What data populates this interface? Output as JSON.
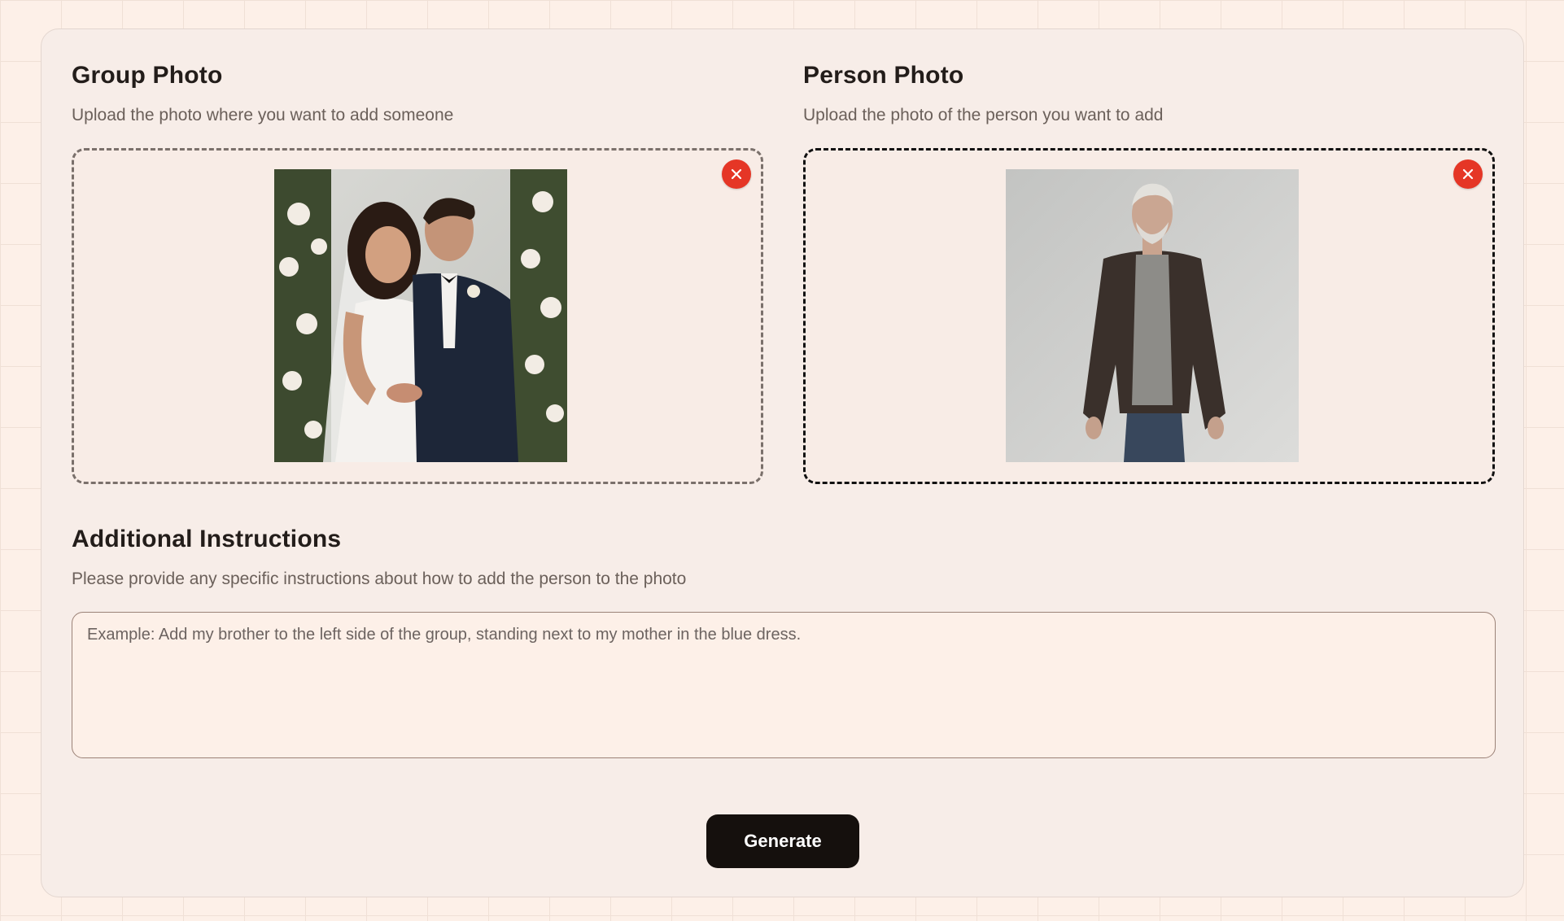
{
  "group_photo": {
    "title": "Group Photo",
    "subtitle": "Upload the photo where you want to add someone",
    "image_alt": "Wedding couple photo"
  },
  "person_photo": {
    "title": "Person Photo",
    "subtitle": "Upload the photo of the person you want to add",
    "image_alt": "Elderly man portrait"
  },
  "instructions": {
    "title": "Additional Instructions",
    "subtitle": "Please provide any specific instructions about how to add the person to the photo",
    "placeholder": "Example: Add my brother to the left side of the group, standing next to my mother in the blue dress.",
    "value": ""
  },
  "actions": {
    "generate_label": "Generate"
  },
  "icons": {
    "remove": "close-icon"
  },
  "colors": {
    "remove_button": "#e53626",
    "primary_button": "#15100d",
    "page_background": "#fdf0e8",
    "card_background": "#f7ede8"
  }
}
